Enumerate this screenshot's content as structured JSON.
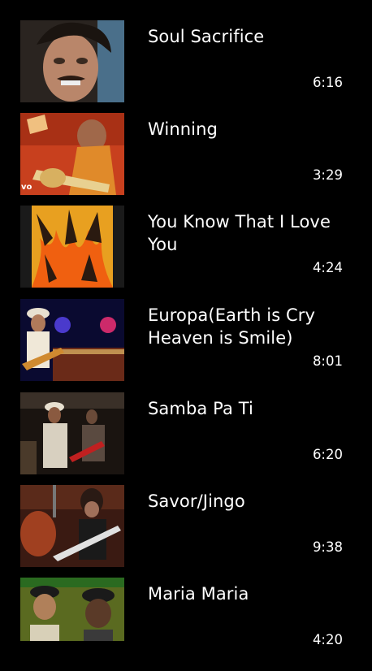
{
  "tracks": [
    {
      "title": "Soul Sacrifice",
      "duration": "6:16"
    },
    {
      "title": "Winning",
      "duration": "3:29"
    },
    {
      "title": "You Know That I Love You",
      "duration": "4:24"
    },
    {
      "title": "Europa(Earth is Cry Heaven is Smile)",
      "duration": "8:01"
    },
    {
      "title": "Samba Pa Ti",
      "duration": "6:20"
    },
    {
      "title": "Savor/Jingo",
      "duration": "9:38"
    },
    {
      "title": "Maria Maria",
      "duration": "4:20"
    }
  ],
  "thumbnail_watermark": "vo"
}
